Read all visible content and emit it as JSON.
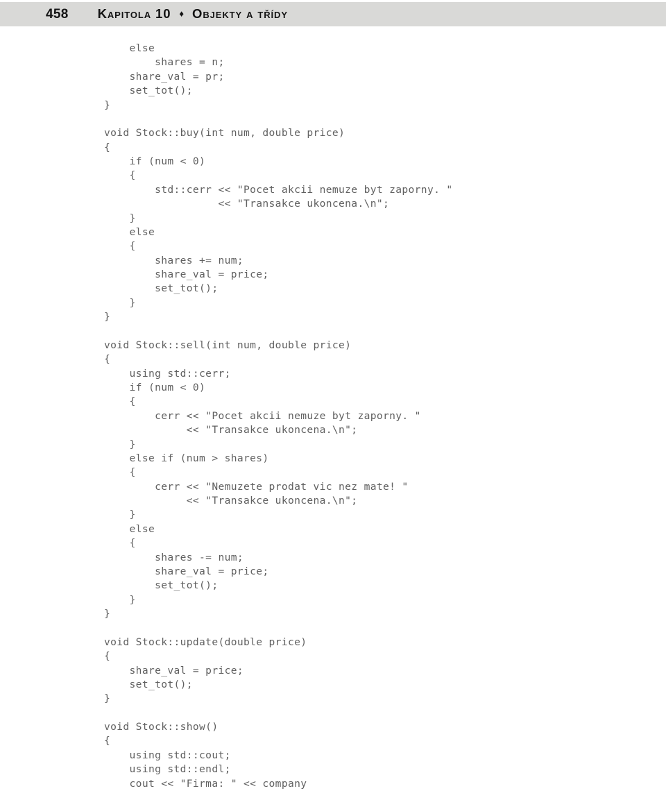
{
  "header": {
    "page_number": "458",
    "chapter_label": "Kapitola 10",
    "separator_icon": "diamond-icon",
    "separator_glyph": "♦",
    "chapter_title": "Objekty a třídy",
    "band_color": "#d9d9d7",
    "text_color": "#141414"
  },
  "body": {
    "text_color": "#606060",
    "background_color": "#ffffff",
    "code_lines": [
      "    else",
      "        shares = n;",
      "    share_val = pr;",
      "    set_tot();",
      "}",
      "",
      "void Stock::buy(int num, double price)",
      "{",
      "    if (num < 0)",
      "    {",
      "        std::cerr << \"Pocet akcii nemuze byt zaporny. \"",
      "                  << \"Transakce ukoncena.\\n\";",
      "    }",
      "    else",
      "    {",
      "        shares += num;",
      "        share_val = price;",
      "        set_tot();",
      "    }",
      "}",
      "",
      "void Stock::sell(int num, double price)",
      "{",
      "    using std::cerr;",
      "    if (num < 0)",
      "    {",
      "        cerr << \"Pocet akcii nemuze byt zaporny. \"",
      "             << \"Transakce ukoncena.\\n\";",
      "    }",
      "    else if (num > shares)",
      "    {",
      "        cerr << \"Nemuzete prodat vic nez mate! \"",
      "             << \"Transakce ukoncena.\\n\";",
      "    }",
      "    else",
      "    {",
      "        shares -= num;",
      "        share_val = price;",
      "        set_tot();",
      "    }",
      "}",
      "",
      "void Stock::update(double price)",
      "{",
      "    share_val = price;",
      "    set_tot();",
      "}",
      "",
      "void Stock::show()",
      "{",
      "    using std::cout;",
      "    using std::endl;",
      "    cout << \"Firma: \" << company"
    ]
  }
}
